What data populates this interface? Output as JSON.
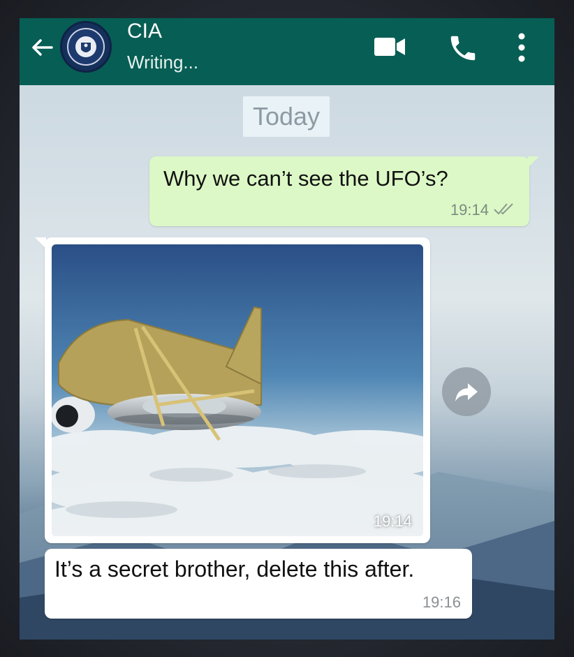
{
  "header": {
    "contact_name": "CIA",
    "status": "Writing...",
    "avatar_icon": "cia-seal-icon",
    "icons": [
      "back-arrow-icon",
      "video-camera-icon",
      "phone-icon",
      "more-vertical-icon"
    ],
    "background_color": "#075e54"
  },
  "chat": {
    "date_chip": "Today",
    "messages": [
      {
        "direction": "outgoing",
        "text": "Why we can’t see the UFO’s?",
        "time": "19:14",
        "status_icon": "double-check-icon"
      },
      {
        "direction": "incoming",
        "type": "image",
        "time": "19:14",
        "forward_icon": "forward-share-icon"
      },
      {
        "direction": "incoming",
        "text": "It’s a secret brother, delete this after.",
        "time": "19:16"
      }
    ],
    "outgoing_color": "#dcf8c6",
    "incoming_color": "#ffffff"
  }
}
